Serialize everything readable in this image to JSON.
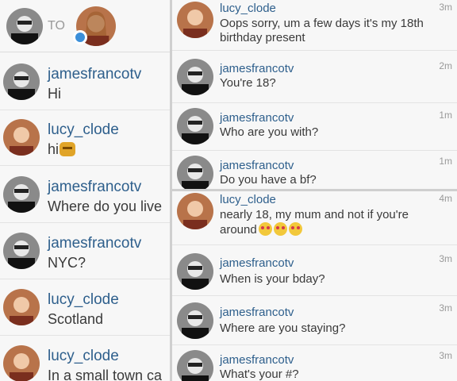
{
  "left": {
    "to_label": "TO",
    "messages": [
      {
        "user": "jamesfrancotv",
        "text": "Hi"
      },
      {
        "user": "lucy_clode",
        "text": "hi"
      },
      {
        "user": "jamesfrancotv",
        "text": "Where do you live"
      },
      {
        "user": "jamesfrancotv",
        "text": "NYC?"
      },
      {
        "user": "lucy_clode",
        "text": "Scotland"
      },
      {
        "user": "lucy_clode",
        "text": "In a small town ca"
      }
    ]
  },
  "right_top": {
    "messages": [
      {
        "user": "lucy_clode",
        "text": "Oops sorry, um a few days it's my 18th birthday present",
        "time": "3m"
      },
      {
        "user": "jamesfrancotv",
        "text": "You're 18?",
        "time": "2m"
      },
      {
        "user": "jamesfrancotv",
        "text": "Who are you with?",
        "time": "1m"
      },
      {
        "user": "jamesfrancotv",
        "text": "Do you have a bf?",
        "time": "1m"
      }
    ]
  },
  "right_bottom": {
    "messages": [
      {
        "user": "lucy_clode",
        "text": "nearly 18, my mum and not if you're around",
        "time": "4m"
      },
      {
        "user": "jamesfrancotv",
        "text": "When is your bday?",
        "time": "3m"
      },
      {
        "user": "jamesfrancotv",
        "text": "Where are you staying?",
        "time": "3m"
      },
      {
        "user": "jamesfrancotv",
        "text": "What's your #?",
        "time": "3m"
      }
    ]
  },
  "icons": {
    "male_avatar": "male-avatar-icon",
    "female_avatar": "female-avatar-icon"
  },
  "colors": {
    "username": "#2e5f8c",
    "text": "#3a3a3a",
    "divider": "#cfcfcf"
  }
}
